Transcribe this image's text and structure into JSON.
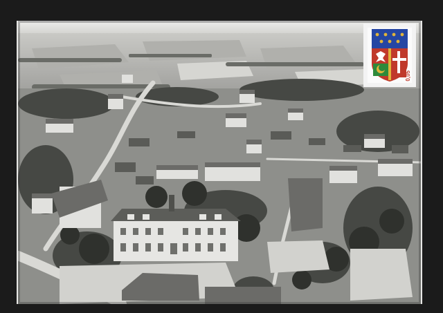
{
  "scene": {
    "kind": "aerial black-and-white photo postcard",
    "tone": "monochrome",
    "colors": {
      "frame": "#1b1b1b",
      "sky": "#e6e6e4",
      "field": "#b9b9b6",
      "foliage": "#3f413d",
      "roof": "#6d6d6a",
      "wall": "#e2e2df",
      "road": "#cfcfcc"
    }
  },
  "stamp": {
    "icon": "coat-of-arms-stamp-icon",
    "value_text": "0,05",
    "colors": {
      "blue": "#2546a3",
      "red": "#c0392b",
      "gold": "#e0b43a",
      "green": "#2e8a3a",
      "white": "#ffffff"
    }
  }
}
